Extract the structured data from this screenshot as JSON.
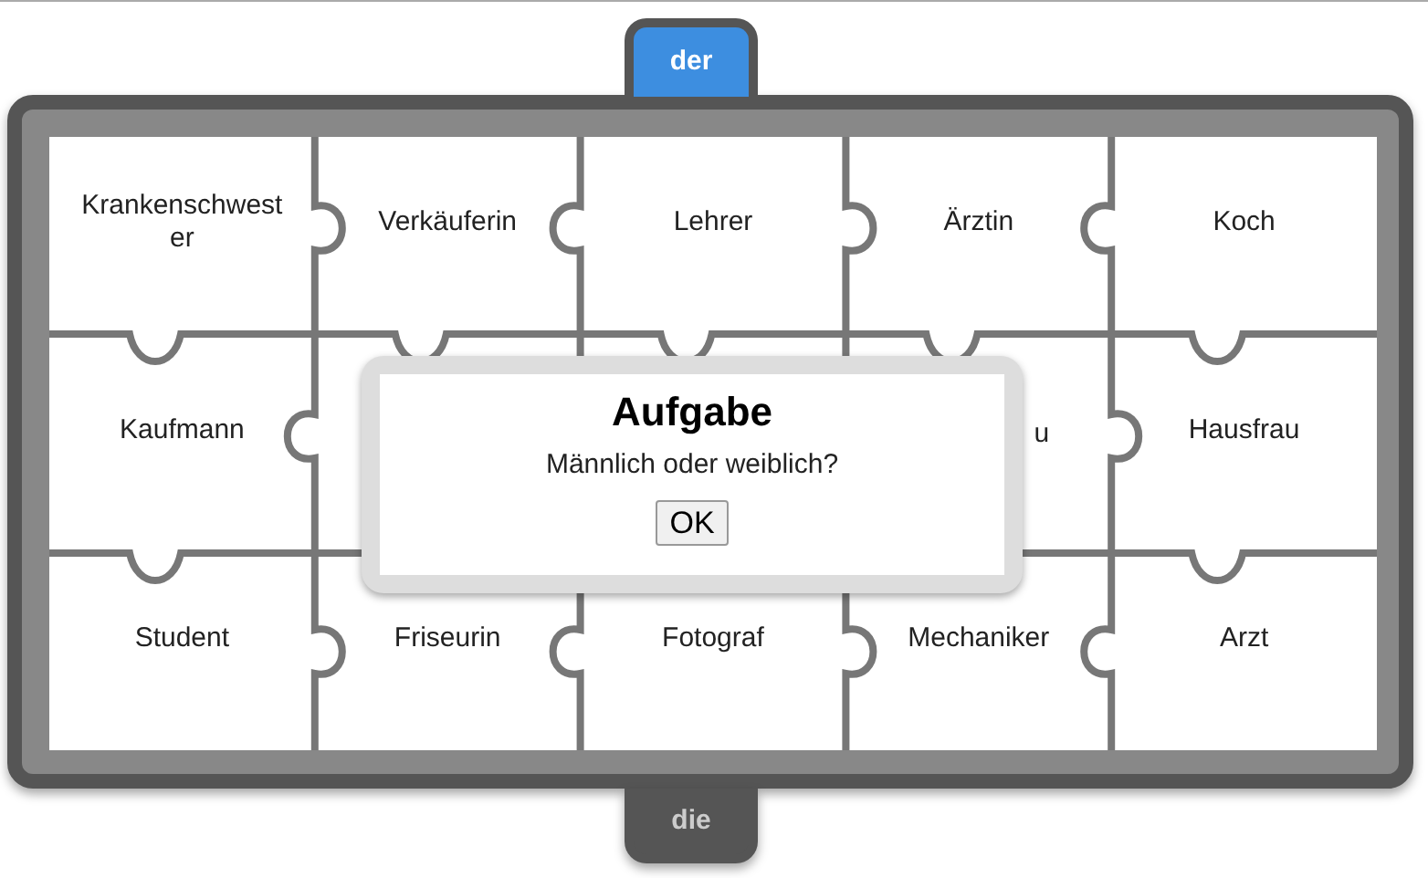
{
  "tabs": [
    {
      "label": "der",
      "selected": true
    },
    {
      "label": "die",
      "selected": false
    }
  ],
  "tiles": [
    {
      "kind": "word",
      "label": "Krankenschwester"
    },
    {
      "kind": "word",
      "label": "Verkäuferin"
    },
    {
      "kind": "word",
      "label": "Lehrer"
    },
    {
      "kind": "word",
      "label": "Ärztin"
    },
    {
      "kind": "word",
      "label": "Koch"
    },
    {
      "kind": "word",
      "label": "Kaufmann"
    },
    {
      "kind": "covered"
    },
    {
      "kind": "covered"
    },
    {
      "kind": "covered",
      "label": "u"
    },
    {
      "kind": "word",
      "label": "Hausfrau"
    },
    {
      "kind": "word",
      "label": "Student"
    },
    {
      "kind": "word",
      "label": "Friseurin"
    },
    {
      "kind": "word",
      "label": "Fotograf"
    },
    {
      "kind": "word",
      "label": "Mechaniker"
    },
    {
      "kind": "word",
      "label": "Arzt"
    }
  ],
  "dialog": {
    "title": "Aufgabe",
    "message": "Männlich oder weiblich?",
    "button": "OK"
  }
}
